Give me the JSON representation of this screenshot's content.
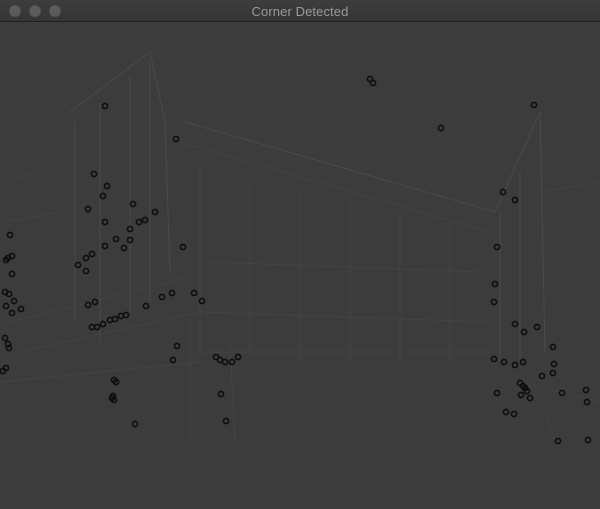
{
  "window": {
    "title": "Corner Detected"
  },
  "buttons": {
    "close_icon": "close-icon",
    "minimize_icon": "minimize-icon",
    "maximize_icon": "maximize-icon"
  },
  "image": {
    "description_kind": "edge-filtered photo with detected corner markers",
    "marker_color": "#0d0d0d",
    "background_color": "#3c3c3c",
    "corner_count": 121
  }
}
